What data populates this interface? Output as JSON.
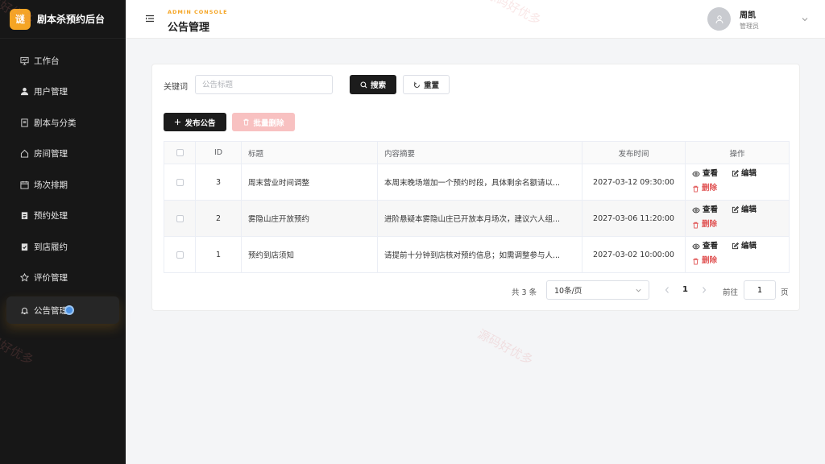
{
  "brand": {
    "logo_char": "谜",
    "title": "剧本杀预约后台",
    "accent": "#f5a524"
  },
  "sidebar": {
    "items": [
      {
        "label": "工作台",
        "icon": "monitor-icon"
      },
      {
        "label": "用户管理",
        "icon": "user-icon"
      },
      {
        "label": "剧本与分类",
        "icon": "book-icon"
      },
      {
        "label": "房间管理",
        "icon": "house-icon"
      },
      {
        "label": "场次排期",
        "icon": "calendar-icon"
      },
      {
        "label": "预约处理",
        "icon": "clipboard-icon"
      },
      {
        "label": "到店履约",
        "icon": "check-clipboard-icon"
      },
      {
        "label": "评价管理",
        "icon": "star-icon"
      },
      {
        "label": "公告管理",
        "icon": "bell-icon",
        "active": true
      }
    ]
  },
  "header": {
    "subtitle": "ADMIN CONSOLE",
    "title": "公告管理",
    "user_name": "周凯",
    "user_role": "管理员"
  },
  "filter": {
    "keyword_label": "关键词",
    "keyword_placeholder": "公告标题",
    "keyword_value": "",
    "search_label": "搜索",
    "reset_label": "重置"
  },
  "actions": {
    "publish_label": "发布公告",
    "batch_delete_label": "批量删除"
  },
  "table": {
    "columns": [
      "ID",
      "标题",
      "内容摘要",
      "发布时间",
      "操作"
    ],
    "rows": [
      {
        "id": "3",
        "title": "周末营业时间调整",
        "summary": "本周末晚场增加一个预约时段，具体剩余名额请以...",
        "time": "2027-03-12 09:30:00"
      },
      {
        "id": "2",
        "title": "雾隐山庄开放预约",
        "summary": "进阶悬疑本雾隐山庄已开放本月场次，建议六人组...",
        "time": "2027-03-06 11:20:00"
      },
      {
        "id": "1",
        "title": "预约到店须知",
        "summary": "请提前十分钟到店核对预约信息；如需调整参与人...",
        "time": "2027-03-02 10:00:00"
      }
    ],
    "op_view": "查看",
    "op_edit": "编辑",
    "op_delete": "删除"
  },
  "pagination": {
    "total_text": "共 3 条",
    "page_size": "10条/页",
    "current_page": "1",
    "goto_label": "前往",
    "goto_value": "1",
    "page_suffix": "页"
  },
  "watermark": "源码好优多"
}
